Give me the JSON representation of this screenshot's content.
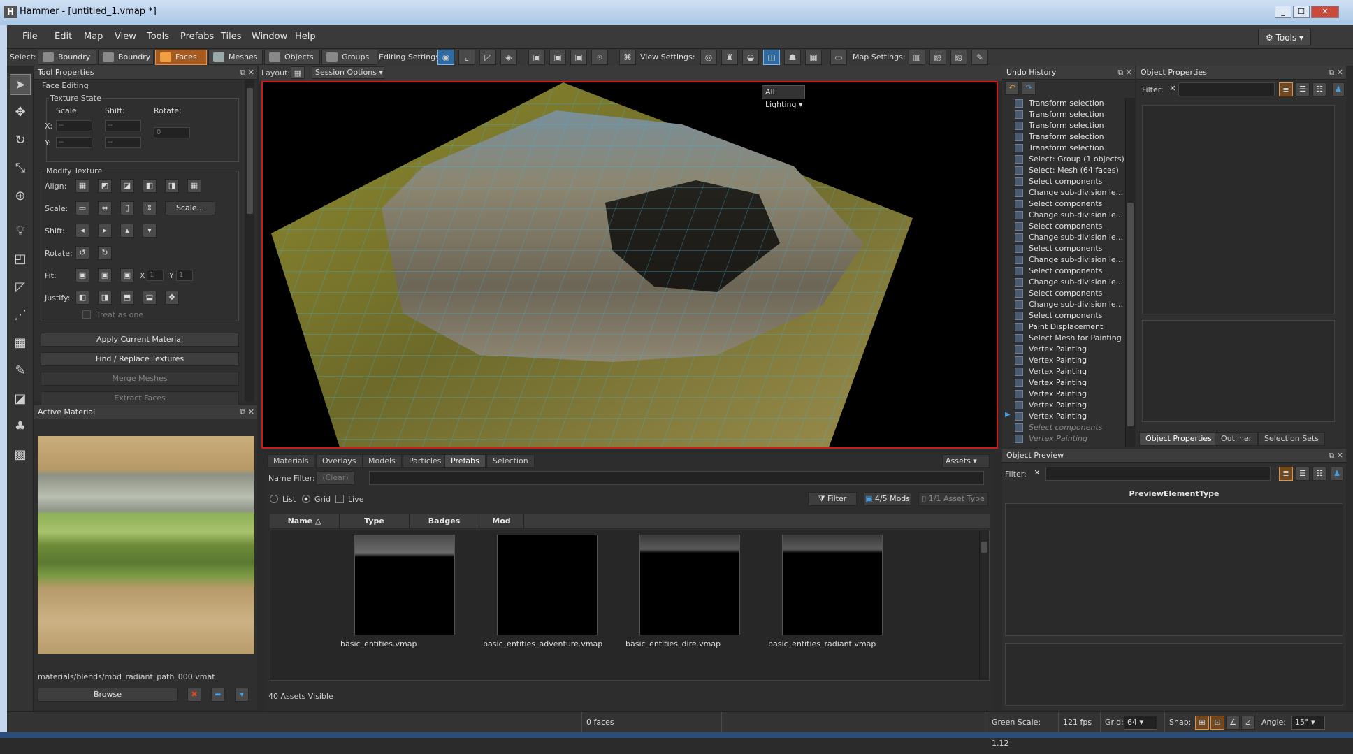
{
  "window": {
    "title": "Hammer - [untitled_1.vmap *]",
    "min": "_",
    "max": "☐",
    "close": "✕"
  },
  "menu": [
    "File",
    "Edit",
    "Map",
    "View",
    "Tools",
    "Prefabs",
    "Tiles",
    "Window",
    "Help"
  ],
  "tools_button": "Tools",
  "toolbar": {
    "select_label": "Select:",
    "modes": [
      "Boundry",
      "Boundry",
      "Faces",
      "Meshes",
      "Objects",
      "Groups"
    ],
    "editing_label": "Editing Settings:",
    "view_label": "View Settings:",
    "map_label": "Map Settings:"
  },
  "tool_properties": {
    "title": "Tool Properties",
    "group": "Face Editing",
    "texture_state": "Texture State",
    "scale": "Scale:",
    "shift": "Shift:",
    "rotate": "Rotate:",
    "x": "X:",
    "y": "Y:",
    "dash": "--",
    "rotate_val": "0",
    "modify_texture": "Modify Texture",
    "align": "Align:",
    "scale_row": "Scale:",
    "scale_btn": "Scale...",
    "shift_row": "Shift:",
    "rotate_row": "Rotate:",
    "fit": "Fit:",
    "fit_x": "X",
    "fit_y": "Y",
    "fit_x_val": "1",
    "fit_y_val": "1",
    "justify": "Justify:",
    "treat_as_one": "Treat as one",
    "apply": "Apply Current Material",
    "find_replace": "Find / Replace Textures",
    "merge": "Merge Meshes",
    "extract": "Extract Faces"
  },
  "active_material": {
    "title": "Active Material",
    "path": "materials/blends/mod_radiant_path_000.vmat",
    "browse": "Browse"
  },
  "viewport": {
    "layout": "Layout:",
    "session": "Session Options",
    "lighting": "All Lighting"
  },
  "undo": {
    "title": "Undo History",
    "items": [
      "Transform selection",
      "Transform selection",
      "Transform selection",
      "Transform selection",
      "Transform selection",
      "Select: Group (1 objects)",
      "Select: Mesh (64 faces)",
      "Select components",
      "Change sub-division le...",
      "Select components",
      "Change sub-division le...",
      "Select components",
      "Change sub-division le...",
      "Select components",
      "Change sub-division le...",
      "Select components",
      "Change sub-division le...",
      "Select components",
      "Change sub-division le...",
      "Select components",
      "Paint Displacement",
      "Select Mesh for Painting",
      "Vertex Painting",
      "Vertex Painting",
      "Vertex Painting",
      "Vertex Painting",
      "Vertex Painting",
      "Vertex Painting",
      "Vertex Painting"
    ],
    "future": [
      "Select components",
      "Vertex Painting"
    ]
  },
  "object_properties": {
    "title": "Object Properties",
    "filter": "Filter:",
    "tabs": [
      "Object Properties",
      "Outliner",
      "Selection Sets"
    ]
  },
  "object_preview": {
    "title": "Object Preview",
    "filter": "Filter:",
    "element": "PreviewElementType"
  },
  "assets": {
    "tabs": [
      "Materials",
      "Overlays",
      "Models",
      "Particles",
      "Prefabs",
      "Selection"
    ],
    "assets_btn": "Assets",
    "name_filter": "Name Filter:",
    "clear": "(Clear)",
    "list": "List",
    "grid": "Grid",
    "live": "Live",
    "filter_btn": "Filter",
    "mods": "4/5 Mods",
    "asset_type": "1/1 Asset Type",
    "columns": [
      "Name",
      "Type",
      "Badges",
      "Mod"
    ],
    "items": [
      "basic_entities.vmap",
      "basic_entities_adventure.vmap",
      "basic_entities_dire.vmap",
      "basic_entities_radiant.vmap"
    ],
    "visible": "40 Assets Visible"
  },
  "status": {
    "faces": "0 faces",
    "green_scale": "Green Scale: 1.12",
    "fps": "121 fps",
    "grid_label": "Grid:",
    "grid_val": "64",
    "snap": "Snap:",
    "angle_label": "Angle:",
    "angle_val": "15°"
  }
}
